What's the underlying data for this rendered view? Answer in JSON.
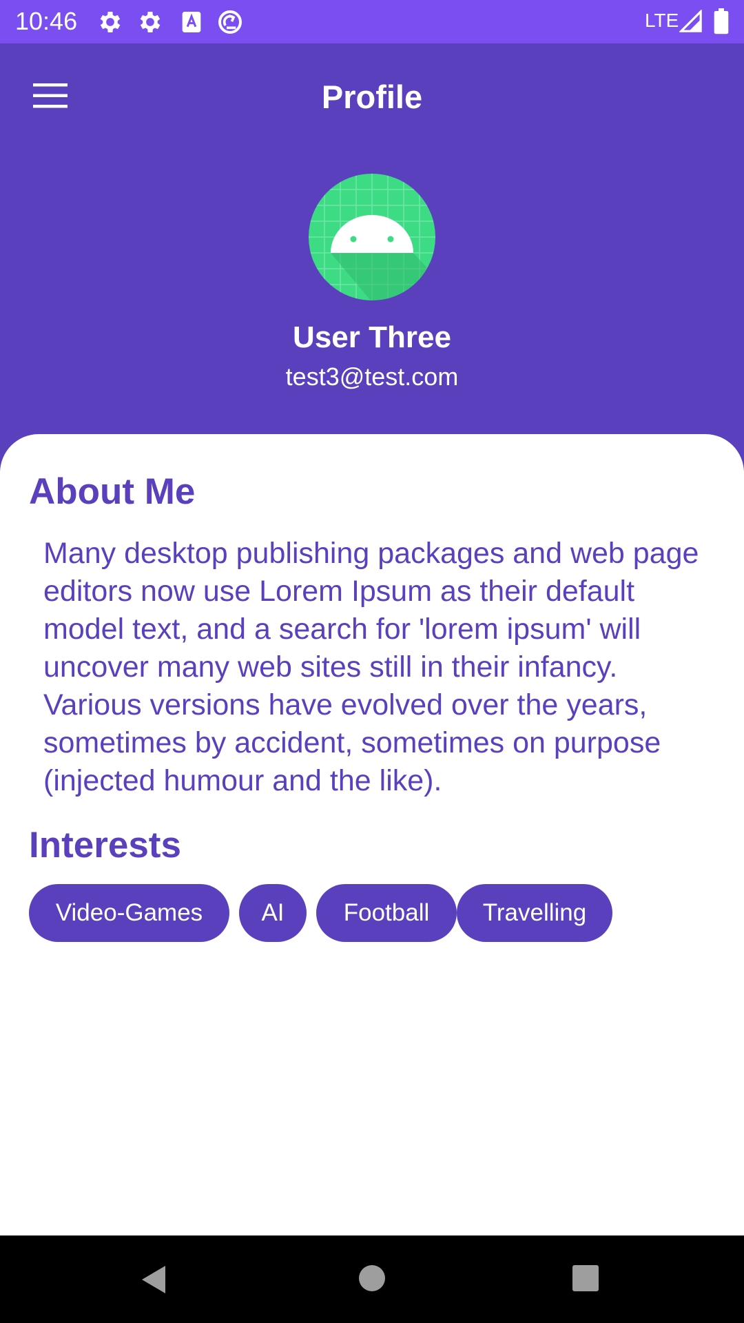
{
  "status_bar": {
    "time": "10:46",
    "network": "LTE",
    "icons": [
      "gear-icon",
      "gear-icon",
      "keyboard-a-icon",
      "sync-icon",
      "signal-icon",
      "battery-icon"
    ]
  },
  "header": {
    "title": "Profile",
    "menu_icon": "hamburger-menu-icon",
    "avatar_icon": "android-robot-icon",
    "user_name": "User Three",
    "user_email": "test3@test.com"
  },
  "about": {
    "heading": "About Me",
    "text": "Many desktop publishing packages and web page editors now use Lorem Ipsum as their default model text, and a search for 'lorem ipsum' will uncover many web sites still in their infancy. Various versions have evolved over the years, sometimes by accident, sometimes on purpose (injected humour and the like)."
  },
  "interests": {
    "heading": "Interests",
    "items": [
      "Video-Games",
      "AI",
      "Football",
      "Travelling"
    ]
  },
  "nav_bar": {
    "buttons": [
      "back-triangle-icon",
      "home-circle-icon",
      "recents-square-icon"
    ]
  },
  "colors": {
    "status_bar": "#7a4ef0",
    "primary": "#5b40bd",
    "avatar_green": "#3ddc84",
    "background": "#ffffff",
    "nav_bar": "#000000",
    "nav_icon": "#9e9e9e"
  }
}
